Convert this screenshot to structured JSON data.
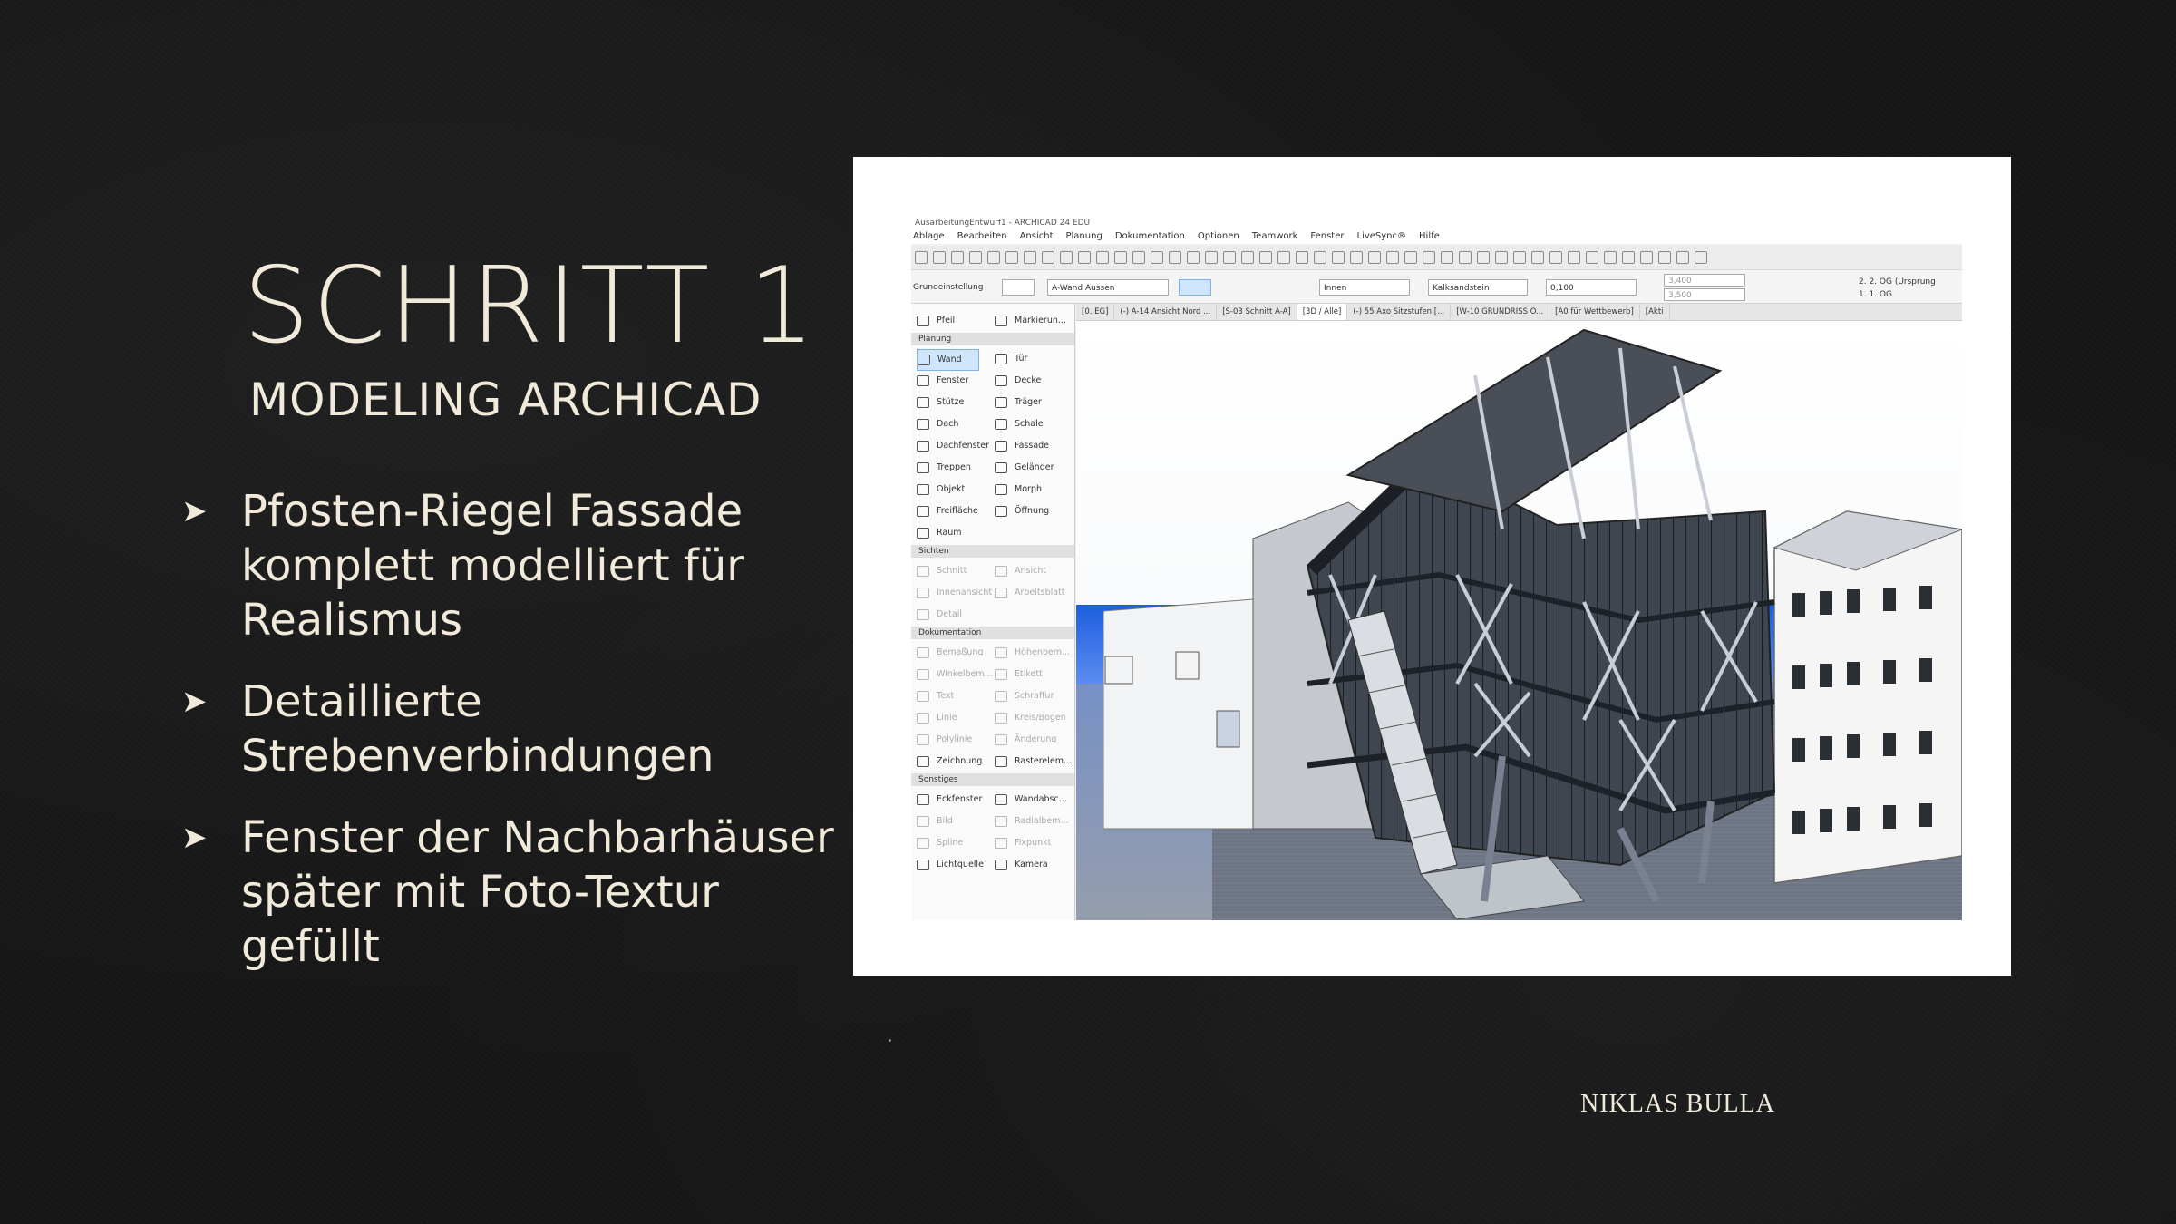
{
  "slide": {
    "title": "SCHRITT 1",
    "subtitle": "MODELING ARCHICAD",
    "bullets": [
      "Pfosten-Riegel Fassade komplett modelliert für Realismus",
      "Detaillierte Strebenverbindungen",
      "Fenster der Nachbarhäuser später mit Foto-Textur gefüllt"
    ],
    "bullet_icon": "arrowhead-icon",
    "author": "NIKLAS BULLA"
  },
  "app": {
    "window_title": "AusarbeitungEntwurf1 - ARCHICAD 24 EDU",
    "menu": [
      "Ablage",
      "Bearbeiten",
      "Ansicht",
      "Planung",
      "Dokumentation",
      "Optionen",
      "Teamwork",
      "Fenster",
      "LiveSync®",
      "Hilfe"
    ],
    "infobox": {
      "label": "Grundeinstellung",
      "wall_type": "A-Wand Aussen",
      "side": "Innen",
      "material": "Kalksandstein",
      "thickness": "0,100",
      "height1": "3,400",
      "height2": "3,500",
      "story_top": "2. 2. OG (Ursprung",
      "story_bottom": "1. 1. OG"
    },
    "tabs": [
      "[0. EG]",
      "(-) A-14 Ansicht Nord ...",
      "[S-03 Schnitt A-A]",
      "[3D / Alle]",
      "(-) 55 Axo Sitzstufen [...",
      "[W-10 GRUNDRISS O...",
      "[A0 für Wettbewerb]",
      "[Akti"
    ],
    "active_tab": "[3D / Alle]",
    "toolbox": {
      "top": [
        [
          "Pfeil",
          "Markierun..."
        ]
      ],
      "sections": [
        {
          "name": "Planung",
          "rows": [
            [
              "Wand",
              "Tür"
            ],
            [
              "Fenster",
              "Decke"
            ],
            [
              "Stütze",
              "Träger"
            ],
            [
              "Dach",
              "Schale"
            ],
            [
              "Dachfenster",
              "Fassade"
            ],
            [
              "Treppen",
              "Geländer"
            ],
            [
              "Objekt",
              "Morph"
            ],
            [
              "Freifläche",
              "Öffnung"
            ],
            [
              "Raum",
              ""
            ]
          ]
        },
        {
          "name": "Sichten",
          "rows": [
            [
              "Schnitt",
              "Ansicht"
            ],
            [
              "Innenansicht",
              "Arbeitsblatt"
            ],
            [
              "Detail",
              ""
            ]
          ]
        },
        {
          "name": "Dokumentation",
          "rows": [
            [
              "Bemaßung",
              "Höhenbem..."
            ],
            [
              "Winkelbem...",
              "Etikett"
            ],
            [
              "Text",
              "Schraffur"
            ],
            [
              "Linie",
              "Kreis/Bogen"
            ],
            [
              "Polylinie",
              "Änderung"
            ],
            [
              "Zeichnung",
              "Rasterelem..."
            ]
          ]
        },
        {
          "name": "Sonstiges",
          "rows": [
            [
              "Eckfenster",
              "Wandabsc..."
            ],
            [
              "Bild",
              "Radialbem..."
            ],
            [
              "Spline",
              "Fixpunkt"
            ],
            [
              "Lichtquelle",
              "Kamera"
            ]
          ]
        }
      ]
    },
    "colors": {
      "accent": "#2f6fdc",
      "selection": "#cfe5fb"
    }
  }
}
